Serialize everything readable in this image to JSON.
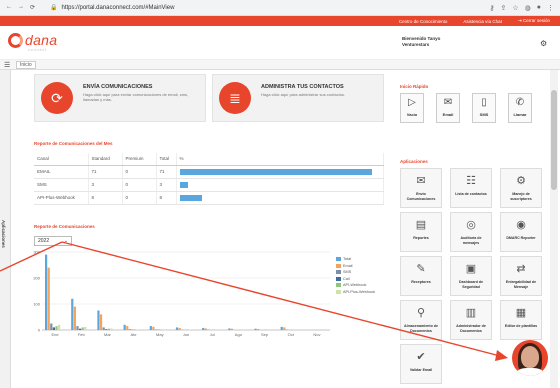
{
  "browser": {
    "url": "https://portal.danaconnect.com/#MainView"
  },
  "topbar": {
    "links": [
      "Centro de Conocimiento",
      "Asistencia vía Chat",
      "Cerrar sesión"
    ]
  },
  "header": {
    "logo_text": "dana",
    "logo_sub": "connect",
    "welcome": "Bienvenido Tanyo",
    "company": "Venturestars"
  },
  "breadcrumb": "Inicio",
  "sidebar_tab": "Aplicaciones",
  "cards": [
    {
      "title": "ENVÍA COMUNICACIONES",
      "desc": "Haga click aquí para enviar comunicaciones de email, sms, llamadas y más."
    },
    {
      "title": "ADMINISTRA TUS CONTACTOS",
      "desc": "Haga click aquí para administrar sus contactos."
    }
  ],
  "quick_access": {
    "title": "Inicio Rápido",
    "items": [
      "Vacío",
      "Email",
      "SMS",
      "Llamar"
    ]
  },
  "report": {
    "title": "Reporte de Comunicaciones del Mes",
    "headers": [
      "Canal",
      "Standard",
      "Premium",
      "Total",
      "%"
    ],
    "rows": [
      {
        "canal": "EMAIL",
        "standard": "71",
        "premium": "0",
        "total": "71",
        "pct": 0.96
      },
      {
        "canal": "SMS",
        "standard": "3",
        "premium": "0",
        "total": "3",
        "pct": 0.04
      },
      {
        "canal": "API-Plus-Webhook",
        "standard": "8",
        "premium": "0",
        "total": "8",
        "pct": 0.11
      }
    ]
  },
  "chart_section": {
    "title": "Reporte de Comunicaciones",
    "year": "2022"
  },
  "chart_data": {
    "type": "bar",
    "categories": [
      "Ene",
      "Feb",
      "Mar",
      "Abr",
      "May",
      "Jun",
      "Jul",
      "Ago",
      "Sep",
      "Oct",
      "Nov"
    ],
    "ylim": [
      0,
      300
    ],
    "yticks": [
      "300",
      "200",
      "100",
      "0"
    ],
    "series": [
      {
        "name": "Total",
        "color": "#5aa6de",
        "values": [
          290,
          120,
          75,
          20,
          15,
          10,
          8,
          6,
          5,
          12,
          0
        ]
      },
      {
        "name": "Email",
        "color": "#f5a25d",
        "values": [
          240,
          90,
          60,
          15,
          12,
          8,
          6,
          5,
          4,
          10,
          0
        ]
      },
      {
        "name": "SMS",
        "color": "#7f8fa6",
        "values": [
          25,
          15,
          10,
          3,
          2,
          1,
          1,
          0,
          0,
          1,
          0
        ]
      },
      {
        "name": "Call",
        "color": "#3f6e9e",
        "values": [
          10,
          5,
          3,
          1,
          1,
          0,
          0,
          0,
          0,
          0,
          0
        ]
      },
      {
        "name": "API-Webhook",
        "color": "#93c47d",
        "values": [
          15,
          10,
          5,
          2,
          1,
          1,
          1,
          1,
          1,
          1,
          0
        ]
      },
      {
        "name": "API-Plus-Webhook",
        "color": "#cfe2a8",
        "values": [
          20,
          12,
          6,
          2,
          1,
          1,
          1,
          1,
          1,
          1,
          0
        ]
      }
    ]
  },
  "apps": {
    "title": "Aplicaciones",
    "items": [
      "Envío Comunicaciones",
      "Lista de contactos",
      "Manejo de suscriptores",
      "Reportes",
      "Auditoría de mensajes",
      "DMARC Reporter",
      "Receptores",
      "Dashboard de Seguridad",
      "Entregabilidad de Mensaje",
      "Almacenamiento de Documentos",
      "Administrador de Documentos",
      "Editor de plantillas",
      "Validar Email"
    ]
  }
}
